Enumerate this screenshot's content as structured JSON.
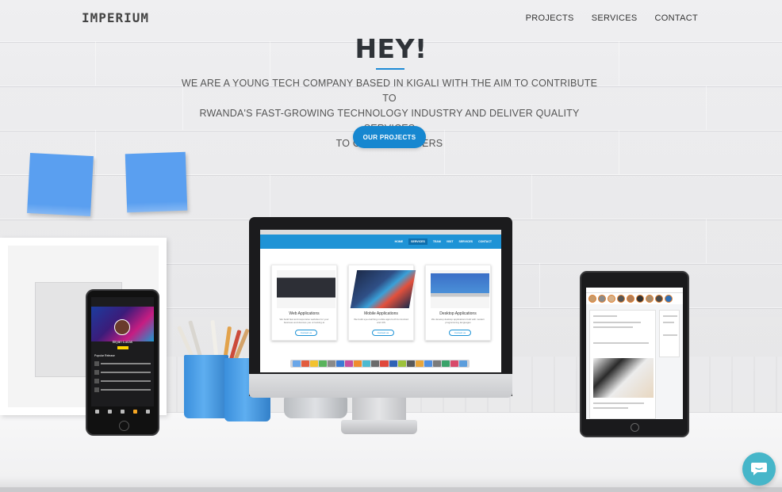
{
  "header": {
    "logo": "IMPERIUM",
    "nav": [
      "PROJECTS",
      "SERVICES",
      "CONTACT"
    ]
  },
  "hero": {
    "title": "HEY!",
    "lines": [
      "WE ARE A YOUNG TECH COMPANY BASED IN KIGALI WITH THE AIM TO CONTRIBUTE TO",
      "RWANDA'S FAST-GROWING TECHNOLOGY INDUSTRY AND DELIVER QUALITY SERVICES",
      "TO OUR CUSTOMERS"
    ],
    "cta": "OUR PROJECTS"
  },
  "monitor_site": {
    "nav": [
      "HOME",
      "SERVICES",
      "TEAM",
      "VISIT",
      "SERVICES",
      "CONTACT"
    ],
    "cards": [
      {
        "title": "Web Applications",
        "desc": "We build fast and responsive websites for your business and devices you ut looking at",
        "button": "Contact us"
      },
      {
        "title": "Mobile Applications",
        "desc": "We build eye-catching mobile apps both for Android and iOS",
        "button": "Contact us"
      },
      {
        "title": "Desktop Applications",
        "desc": "We develop desktop applications built with modern programming languages",
        "button": "Contact us"
      }
    ]
  },
  "phone": {
    "profile_name": "Bryan Lucas",
    "section": "Popular Release"
  },
  "colors": {
    "accent": "#1687d0",
    "note": "#5a9ff0",
    "cup": "#3a8fdc",
    "chat": "#46b6c9"
  },
  "icons": {
    "chat": "chat-bubble-icon"
  }
}
